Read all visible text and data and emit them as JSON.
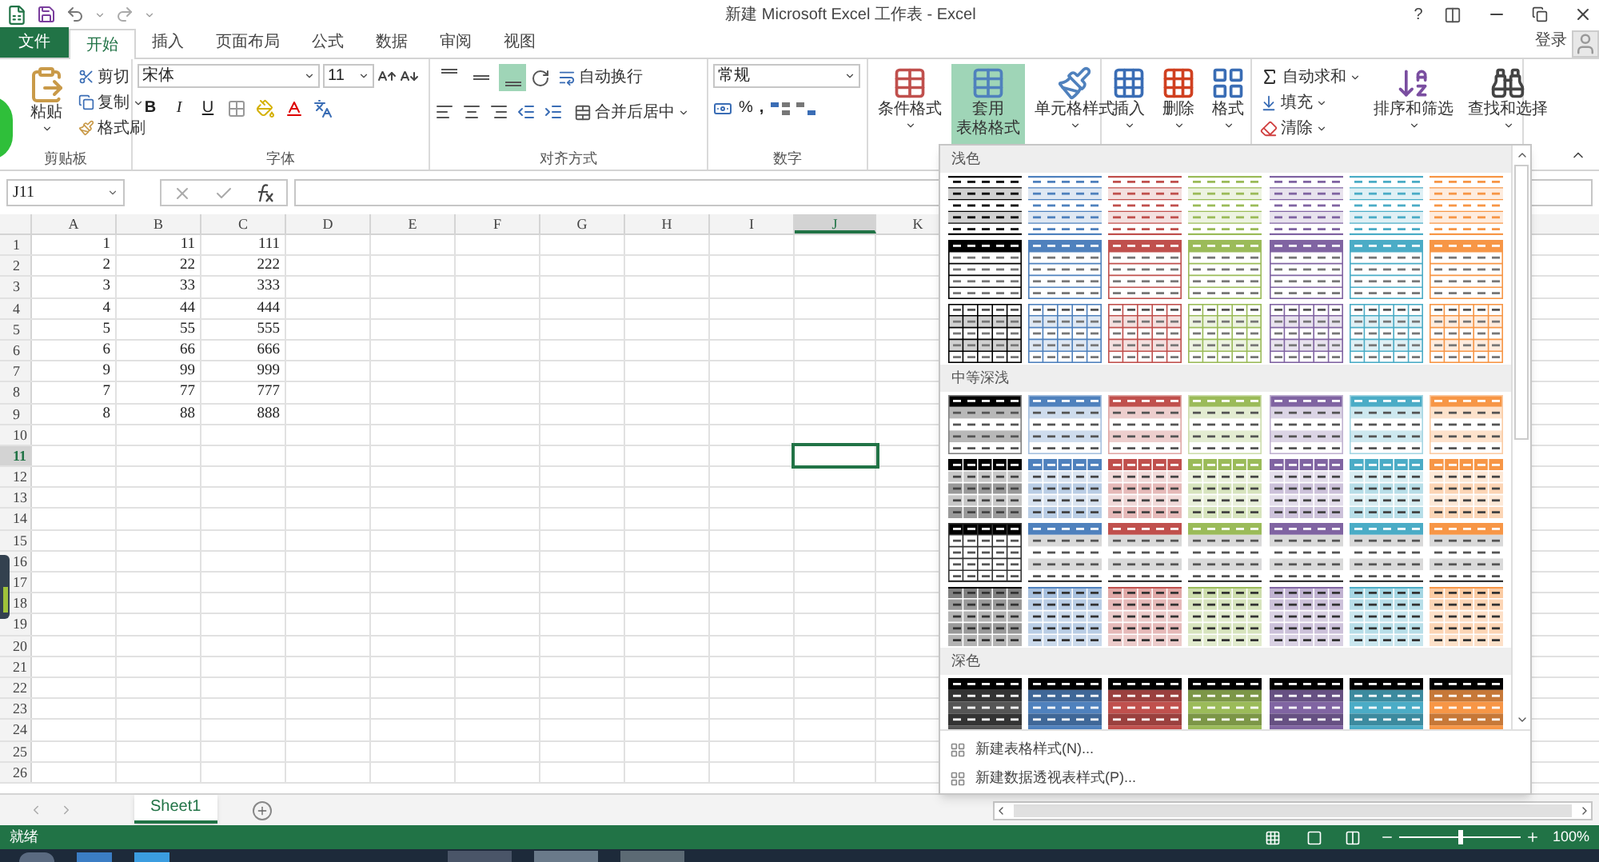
{
  "title_bar": {
    "title": "新建 Microsoft Excel 工作表 - Excel",
    "help": "?"
  },
  "tabs": [
    {
      "label": "文件",
      "kind": "file",
      "selected": false
    },
    {
      "label": "开始",
      "kind": "tab",
      "selected": true
    },
    {
      "label": "插入",
      "kind": "tab",
      "selected": false
    },
    {
      "label": "页面布局",
      "kind": "tab",
      "selected": false
    },
    {
      "label": "公式",
      "kind": "tab",
      "selected": false
    },
    {
      "label": "数据",
      "kind": "tab",
      "selected": false
    },
    {
      "label": "审阅",
      "kind": "tab",
      "selected": false
    },
    {
      "label": "视图",
      "kind": "tab",
      "selected": false
    }
  ],
  "account": {
    "sign_in": "登录"
  },
  "ribbon": {
    "clipboard": {
      "label": "剪贴板",
      "paste": "粘贴",
      "cut": "剪切",
      "copy": "复制",
      "format_painter": "格式刷"
    },
    "font": {
      "label": "字体",
      "font_name": "宋体",
      "font_size": "11",
      "bold": "B",
      "italic": "I",
      "underline": "U"
    },
    "alignment": {
      "label": "对齐方式",
      "wrap_text": "自动换行",
      "merge_center": "合并后居中",
      "vertical_align": [
        {
          "kind": "top",
          "selected": false
        },
        {
          "kind": "middle",
          "selected": false
        },
        {
          "kind": "bottom",
          "selected": true
        }
      ]
    },
    "number": {
      "label": "数字",
      "format": "常规",
      "percent": "%",
      "comma": ","
    },
    "styles": {
      "conditional": "条件格式",
      "table_format": {
        "lines": [
          "套用",
          "表格格式"
        ],
        "selected": true
      },
      "cell_styles": "单元格样式"
    },
    "cells": {
      "insert": "插入",
      "delete": "删除",
      "format": "格式"
    },
    "editing": {
      "autosum": "自动求和",
      "fill": "填充",
      "clear": "清除",
      "sort_filter": "排序和筛选",
      "find_select": "查找和选择"
    }
  },
  "formula_bar": {
    "name_box": "J11"
  },
  "sheet": {
    "columns": [
      {
        "label": "A",
        "selected": false
      },
      {
        "label": "B",
        "selected": false
      },
      {
        "label": "C",
        "selected": false
      },
      {
        "label": "D",
        "selected": false
      },
      {
        "label": "E",
        "selected": false
      },
      {
        "label": "F",
        "selected": false
      },
      {
        "label": "G",
        "selected": false
      },
      {
        "label": "H",
        "selected": false
      },
      {
        "label": "I",
        "selected": false
      },
      {
        "label": "J",
        "selected": true
      },
      {
        "label": "K",
        "selected": false
      }
    ],
    "rows": [
      {
        "label": "1",
        "selected": false,
        "cells": [
          "1",
          "11",
          "111"
        ]
      },
      {
        "label": "2",
        "selected": false,
        "cells": [
          "2",
          "22",
          "222"
        ]
      },
      {
        "label": "3",
        "selected": false,
        "cells": [
          "3",
          "33",
          "333"
        ]
      },
      {
        "label": "4",
        "selected": false,
        "cells": [
          "4",
          "44",
          "444"
        ]
      },
      {
        "label": "5",
        "selected": false,
        "cells": [
          "5",
          "55",
          "555"
        ]
      },
      {
        "label": "6",
        "selected": false,
        "cells": [
          "6",
          "66",
          "666"
        ]
      },
      {
        "label": "7",
        "selected": false,
        "cells": [
          "9",
          "99",
          "999"
        ]
      },
      {
        "label": "8",
        "selected": false,
        "cells": [
          "7",
          "77",
          "777"
        ]
      },
      {
        "label": "9",
        "selected": false,
        "cells": [
          "8",
          "88",
          "888"
        ]
      },
      {
        "label": "10",
        "selected": false,
        "cells": []
      },
      {
        "label": "11",
        "selected": true,
        "cells": []
      },
      {
        "label": "12",
        "selected": false,
        "cells": []
      },
      {
        "label": "13",
        "selected": false,
        "cells": []
      },
      {
        "label": "14",
        "selected": false,
        "cells": []
      },
      {
        "label": "15",
        "selected": false,
        "cells": []
      },
      {
        "label": "16",
        "selected": false,
        "cells": []
      },
      {
        "label": "17",
        "selected": false,
        "cells": []
      },
      {
        "label": "18",
        "selected": false,
        "cells": []
      },
      {
        "label": "19",
        "selected": false,
        "cells": []
      },
      {
        "label": "20",
        "selected": false,
        "cells": []
      },
      {
        "label": "21",
        "selected": false,
        "cells": []
      },
      {
        "label": "22",
        "selected": false,
        "cells": []
      },
      {
        "label": "23",
        "selected": false,
        "cells": []
      },
      {
        "label": "24",
        "selected": false,
        "cells": []
      },
      {
        "label": "25",
        "selected": false,
        "cells": []
      },
      {
        "label": "26",
        "selected": false,
        "cells": []
      }
    ]
  },
  "style_gallery": {
    "colors": [
      {
        "color": "#000000"
      },
      {
        "color": "#4f81bd"
      },
      {
        "color": "#c0504d"
      },
      {
        "color": "#9bbb59"
      },
      {
        "color": "#8064a2"
      },
      {
        "color": "#4bacc6"
      },
      {
        "color": "#f79646"
      }
    ],
    "sections": [
      {
        "title": "浅色",
        "rows": [
          {
            "kind": "light-banded"
          },
          {
            "kind": "light-header"
          },
          {
            "kind": "light-grid"
          }
        ]
      },
      {
        "title": "中等深浅",
        "rows": [
          {
            "kind": "medium-banded"
          },
          {
            "kind": "medium-grid"
          },
          {
            "kind": "medium-lines"
          },
          {
            "kind": "medium-tinted"
          }
        ]
      },
      {
        "title": "深色",
        "rows": [
          {
            "kind": "dark"
          }
        ]
      }
    ],
    "menu": [
      "新建表格样式(N)...",
      "新建数据透视表样式(P)..."
    ]
  },
  "sheet_tabs": [
    {
      "label": "Sheet1",
      "selected": true
    }
  ],
  "status_bar": {
    "status": "就绪",
    "zoom": {
      "level": 0.5,
      "reading": "100%"
    }
  }
}
